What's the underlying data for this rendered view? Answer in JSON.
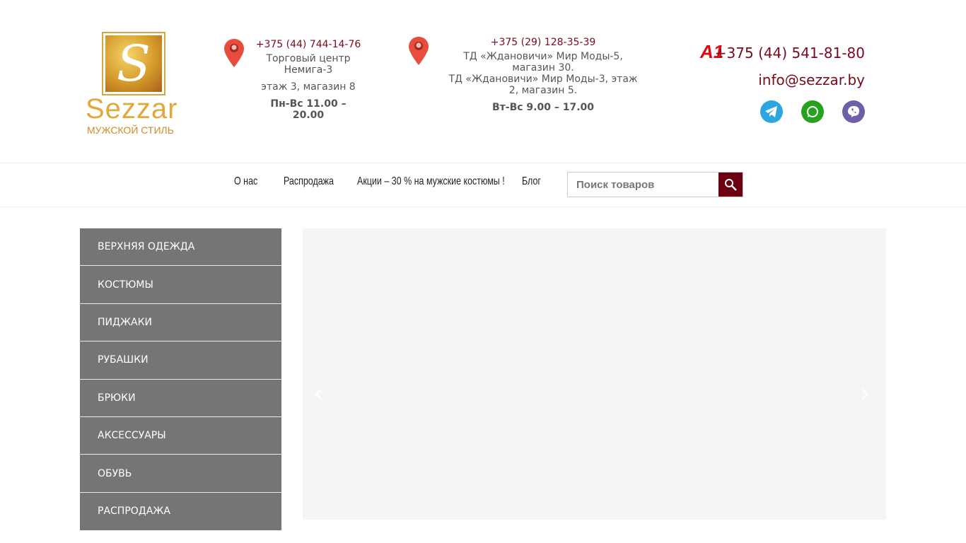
{
  "logo": {
    "mark": "S",
    "name": "Sezzar",
    "tagline": "МУЖСКОЙ СТИЛЬ"
  },
  "store1": {
    "phone": "+375 (44) 744-14-76",
    "address": "Торговый центр Немига-3",
    "floor": "этаж 3, магазин 8",
    "hours": "Пн-Вс 11.00 – 20.00"
  },
  "store2": {
    "phone": "+375 (29) 128-35-39",
    "address1": "ТД «Ждановичи» Мир Моды-5, магазин 30.",
    "address2": "ТД «Ждановичи» Мир Моды-3, этаж 2, магазин 5.",
    "hours": "Вт-Вс 9.00 – 17.00"
  },
  "contact": {
    "operator": "A1",
    "phone": "+375 (44) 541-81-80",
    "email": "info@sezzar.by"
  },
  "nav": {
    "items": [
      "О нас",
      "Распродажа",
      "Акции – 30 % на мужские костюмы !",
      "Блог"
    ],
    "search_placeholder": "Поиск товаров"
  },
  "categories": [
    "ВЕРХНЯЯ ОДЕЖДА",
    "КОСТЮМЫ",
    "ПИДЖАКИ",
    "РУБАШКИ",
    "БРЮКИ",
    "АКСЕССУАРЫ",
    "ОБУВЬ",
    "РАСПРОДАЖА"
  ],
  "slider": {
    "prev": "‹",
    "next": "›"
  },
  "colors": {
    "accent": "#7b0a1c",
    "menu_bg": "#757575",
    "telegram": "#2ca5e0",
    "whatsapp": "#25a31f",
    "viber": "#6f5fab"
  }
}
